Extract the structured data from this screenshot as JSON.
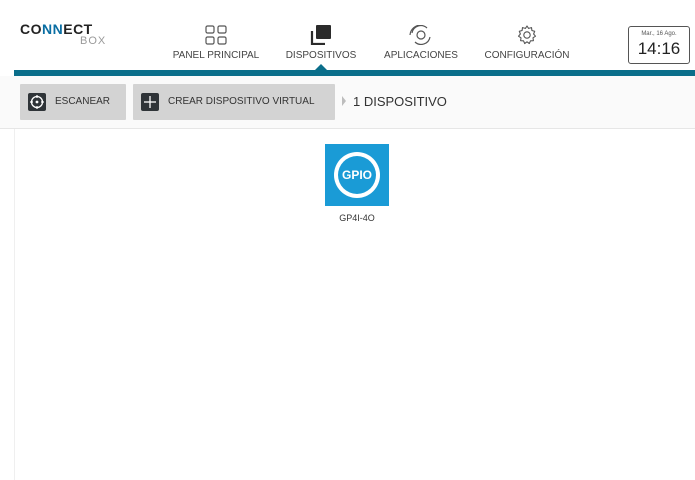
{
  "brand": {
    "logo_line1_a": "CO",
    "logo_line1_b": "NN",
    "logo_line1_c": "ECT",
    "logo_line2": "BOX"
  },
  "nav": {
    "items": [
      {
        "label": "PANEL PRINCIPAL",
        "icon": "grid-icon"
      },
      {
        "label": "DISPOSITIVOS",
        "icon": "devices-icon",
        "active": true
      },
      {
        "label": "APLICACIONES",
        "icon": "apps-icon"
      },
      {
        "label": "CONFIGURACIÓN",
        "icon": "gear-icon"
      }
    ]
  },
  "clock": {
    "date": "Mar., 16 Ago.",
    "time": "14:16"
  },
  "toolbar": {
    "scan_label": "ESCANEAR",
    "create_virtual_label": "CREAR DISPOSITIVO VIRTUAL",
    "device_count": "1 DISPOSITIVO"
  },
  "devices": [
    {
      "icon_text": "GPIO",
      "name": "GP4I-4O"
    }
  ],
  "colors": {
    "accent": "#0a6e8a",
    "device_blue": "#1a9bd6",
    "button_bg": "#d3d3d3"
  }
}
